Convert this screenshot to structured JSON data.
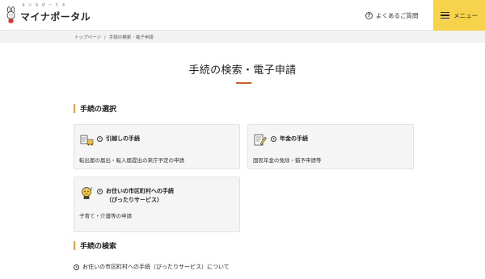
{
  "header": {
    "logo_ruby": "ま い な ぽ ー た る",
    "logo_text": "マイナポータル",
    "faq_label": "よくあるご質問",
    "menu_label": "メニュー"
  },
  "breadcrumb": {
    "items": [
      "トップページ",
      "手続の検索・電子申請"
    ],
    "separator": "/"
  },
  "page": {
    "title": "手続の検索・電子申請"
  },
  "sections": {
    "select_heading": "手続の選択",
    "search_heading": "手続の検索"
  },
  "cards": [
    {
      "title": "引越しの手続",
      "title2": "",
      "desc": "転出届の届出・転入届提出の来庁予定の申請",
      "icon": "moving-icon"
    },
    {
      "title": "年金の手続",
      "title2": "",
      "desc": "国民年金の免除・猶予申請等",
      "icon": "pension-icon"
    },
    {
      "title": "お住いの市区町村への手続",
      "title2": "（ぴったりサービス）",
      "desc": "子育て・介護等の申請",
      "icon": "mascot-icon"
    }
  ],
  "search_link": {
    "label": "お住いの市区町村への手続（ぴったりサービス）について"
  },
  "colors": {
    "menu_bg": "#f6d34a",
    "accent_orange": "#e05a1a",
    "section_bar": "#f0a020"
  }
}
